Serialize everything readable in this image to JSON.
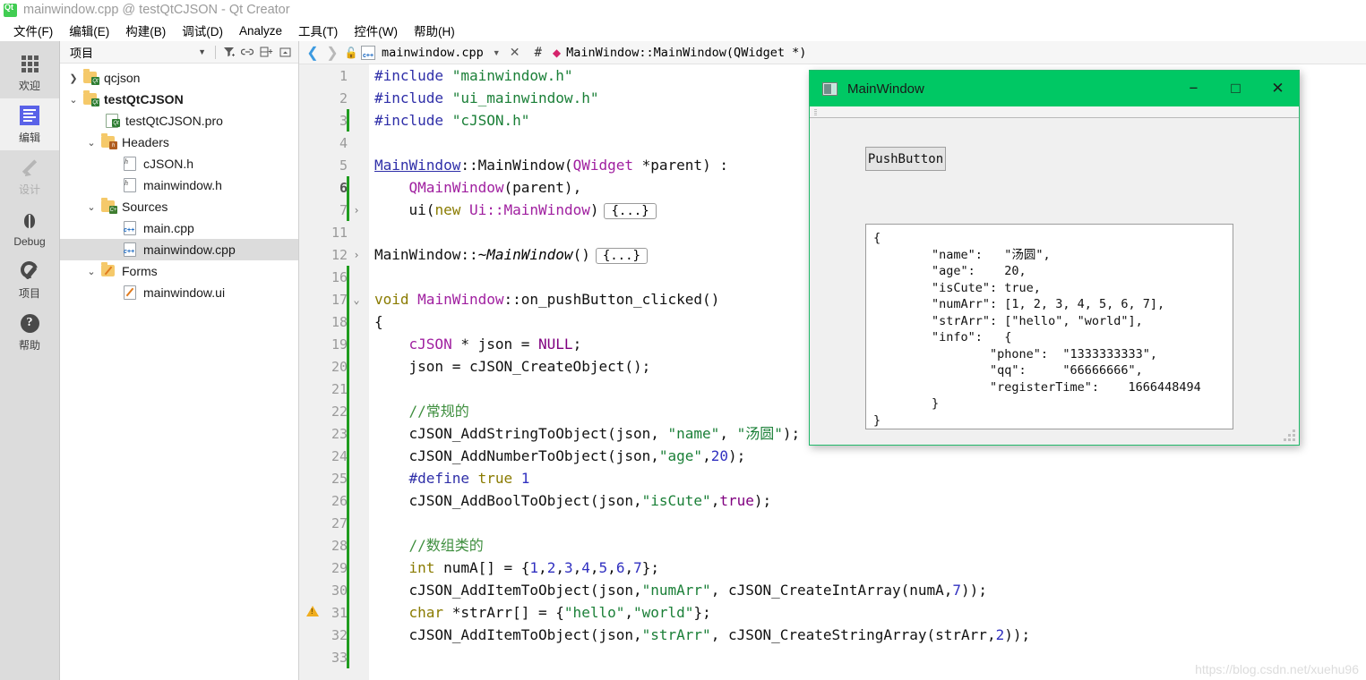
{
  "window": {
    "title": "mainwindow.cpp @ testQtCJSON - Qt Creator",
    "logo_icon": "qt-logo-icon"
  },
  "menubar": {
    "items": [
      {
        "label": "文件(F)",
        "mnemonic": "F"
      },
      {
        "label": "编辑(E)",
        "mnemonic": "E"
      },
      {
        "label": "构建(B)",
        "mnemonic": "B"
      },
      {
        "label": "调试(D)",
        "mnemonic": "D"
      },
      {
        "label": "Analyze",
        "mnemonic": "A"
      },
      {
        "label": "工具(T)",
        "mnemonic": "T"
      },
      {
        "label": "控件(W)",
        "mnemonic": "W"
      },
      {
        "label": "帮助(H)",
        "mnemonic": "H"
      }
    ]
  },
  "modebar": {
    "items": [
      {
        "label": "欢迎",
        "icon": "grid-icon",
        "state": "normal"
      },
      {
        "label": "编辑",
        "icon": "document-edit-icon",
        "state": "selected"
      },
      {
        "label": "设计",
        "icon": "pencil-icon",
        "state": "disabled"
      },
      {
        "label": "Debug",
        "icon": "bug-icon",
        "state": "normal"
      },
      {
        "label": "项目",
        "icon": "wrench-icon",
        "state": "normal"
      },
      {
        "label": "帮助",
        "icon": "question-circle-icon",
        "state": "normal"
      }
    ]
  },
  "sidebar": {
    "header": {
      "combo_label": "项目",
      "caret_icon": "chevron-down-icon",
      "tools": [
        "filter-icon",
        "link-icon",
        "split-icon",
        "collapse-icon"
      ]
    },
    "tree": [
      {
        "label": "qcjson",
        "indent": 0,
        "arrow": "collapsed",
        "icon": "folder-qt-icon",
        "bold": false,
        "selected": false
      },
      {
        "label": "testQtCJSON",
        "indent": 0,
        "arrow": "expanded",
        "icon": "folder-qt-icon",
        "bold": true,
        "selected": false
      },
      {
        "label": "testQtCJSON.pro",
        "indent": 2,
        "arrow": "none",
        "icon": "pro-file-icon",
        "bold": false,
        "selected": false
      },
      {
        "label": "Headers",
        "indent": 1,
        "arrow": "expanded",
        "icon": "folder-h-icon",
        "bold": false,
        "selected": false
      },
      {
        "label": "cJSON.h",
        "indent": 2,
        "arrow": "none",
        "icon": "header-file-icon",
        "bold": false,
        "selected": false
      },
      {
        "label": "mainwindow.h",
        "indent": 2,
        "arrow": "none",
        "icon": "header-file-icon",
        "bold": false,
        "selected": false
      },
      {
        "label": "Sources",
        "indent": 1,
        "arrow": "expanded",
        "icon": "folder-cpp-icon",
        "bold": false,
        "selected": false
      },
      {
        "label": "main.cpp",
        "indent": 2,
        "arrow": "none",
        "icon": "cpp-file-icon",
        "bold": false,
        "selected": false
      },
      {
        "label": "mainwindow.cpp",
        "indent": 2,
        "arrow": "none",
        "icon": "cpp-file-icon",
        "bold": false,
        "selected": true
      },
      {
        "label": "Forms",
        "indent": 1,
        "arrow": "expanded",
        "icon": "folder-ui-icon",
        "bold": false,
        "selected": false
      },
      {
        "label": "mainwindow.ui",
        "indent": 2,
        "arrow": "none",
        "icon": "ui-file-icon",
        "bold": false,
        "selected": false
      }
    ]
  },
  "editor_toolbar": {
    "back_icon": "chevron-left-icon",
    "forward_icon": "chevron-right-icon",
    "lock_icon": "unlocked-icon",
    "file_icon": "cpp-file-icon",
    "filename": "mainwindow.cpp",
    "dropdown_icon": "chevron-down-icon",
    "close_icon": "close-icon",
    "hash_label": "#",
    "symbol_icon": "method-diamond-icon",
    "symbol": "MainWindow::MainWindow(QWidget *)"
  },
  "code": {
    "lines": [
      {
        "num": "1",
        "fold": "",
        "marker": false,
        "warning": false,
        "current": false
      },
      {
        "num": "2",
        "fold": "",
        "marker": false,
        "warning": false,
        "current": false
      },
      {
        "num": "3",
        "fold": "",
        "marker": true,
        "warning": false,
        "current": false
      },
      {
        "num": "4",
        "fold": "",
        "marker": false,
        "warning": false,
        "current": false
      },
      {
        "num": "5",
        "fold": "",
        "marker": false,
        "warning": false,
        "current": false
      },
      {
        "num": "6",
        "fold": "",
        "marker": true,
        "warning": false,
        "current": true
      },
      {
        "num": "7",
        "fold": "›",
        "marker": true,
        "warning": false,
        "current": false
      },
      {
        "num": "11",
        "fold": "",
        "marker": false,
        "warning": false,
        "current": false
      },
      {
        "num": "12",
        "fold": "›",
        "marker": false,
        "warning": false,
        "current": false
      },
      {
        "num": "16",
        "fold": "",
        "marker": true,
        "warning": false,
        "current": false
      },
      {
        "num": "17",
        "fold": "⌄",
        "marker": true,
        "warning": false,
        "current": false
      },
      {
        "num": "18",
        "fold": "",
        "marker": true,
        "warning": false,
        "current": false
      },
      {
        "num": "19",
        "fold": "",
        "marker": true,
        "warning": false,
        "current": false
      },
      {
        "num": "20",
        "fold": "",
        "marker": true,
        "warning": false,
        "current": false
      },
      {
        "num": "21",
        "fold": "",
        "marker": true,
        "warning": false,
        "current": false
      },
      {
        "num": "22",
        "fold": "",
        "marker": true,
        "warning": false,
        "current": false
      },
      {
        "num": "23",
        "fold": "",
        "marker": true,
        "warning": false,
        "current": false
      },
      {
        "num": "24",
        "fold": "",
        "marker": true,
        "warning": false,
        "current": false
      },
      {
        "num": "25",
        "fold": "",
        "marker": true,
        "warning": false,
        "current": false
      },
      {
        "num": "26",
        "fold": "",
        "marker": true,
        "warning": false,
        "current": false
      },
      {
        "num": "27",
        "fold": "",
        "marker": true,
        "warning": false,
        "current": false
      },
      {
        "num": "28",
        "fold": "",
        "marker": true,
        "warning": false,
        "current": false
      },
      {
        "num": "29",
        "fold": "",
        "marker": true,
        "warning": false,
        "current": false
      },
      {
        "num": "30",
        "fold": "",
        "marker": true,
        "warning": false,
        "current": false
      },
      {
        "num": "31",
        "fold": "",
        "marker": true,
        "warning": true,
        "current": false
      },
      {
        "num": "32",
        "fold": "",
        "marker": true,
        "warning": false,
        "current": false
      },
      {
        "num": "33",
        "fold": "",
        "marker": true,
        "warning": false,
        "current": false
      }
    ],
    "text": [
      "#include \"mainwindow.h\"",
      "#include \"ui_mainwindow.h\"",
      "#include \"cJSON.h\"",
      "",
      "MainWindow::MainWindow(QWidget *parent) :",
      "    QMainWindow(parent),",
      "    ui(new Ui::MainWindow) {...}",
      "",
      "MainWindow::~MainWindow() {...}",
      "",
      "void MainWindow::on_pushButton_clicked()",
      "{",
      "    cJSON * json = NULL;",
      "    json = cJSON_CreateObject();",
      "",
      "    //常规的",
      "    cJSON_AddStringToObject(json, \"name\", \"汤圆\");",
      "    cJSON_AddNumberToObject(json,\"age\",20);",
      "    #define true 1",
      "    cJSON_AddBoolToObject(json,\"isCute\",true);",
      "",
      "    //数组类的",
      "    int numA[] = {1,2,3,4,5,6,7};",
      "    cJSON_AddItemToObject(json,\"numArr\", cJSON_CreateIntArray(numA,7));",
      "    char *strArr[] = {\"hello\",\"world\"};",
      "    cJSON_AddItemToObject(json,\"strArr\", cJSON_CreateStringArray(strArr,2));",
      ""
    ],
    "fold_placeholder": "{...}",
    "watermark": "https://blog.csdn.net/xuehu96"
  },
  "dialog": {
    "title": "MainWindow",
    "icon": "window-icon",
    "minimize_icon": "minimize-icon",
    "maximize_icon": "maximize-icon",
    "close_icon": "close-icon",
    "push_button_label": "PushButton",
    "resize_grip_icon": "resize-grip-icon",
    "json_output": "{\n        \"name\":   \"汤圆\",\n        \"age\":    20,\n        \"isCute\": true,\n        \"numArr\": [1, 2, 3, 4, 5, 6, 7],\n        \"strArr\": [\"hello\", \"world\"],\n        \"info\":   {\n                \"phone\":  \"1333333333\",\n                \"qq\":     \"66666666\",\n                \"registerTime\":    1666448494\n        }\n}",
    "json_values": {
      "name": "汤圆",
      "age": 20,
      "isCute": true,
      "numArr": [
        1,
        2,
        3,
        4,
        5,
        6,
        7
      ],
      "strArr": [
        "hello",
        "world"
      ],
      "info": {
        "phone": "1333333333",
        "qq": "66666666",
        "registerTime": 1666448494
      }
    }
  },
  "colors": {
    "accent_green": "#00c864",
    "titlebar_text": "#9b9b9b",
    "selection": "#dcdcdc",
    "gutter_bg": "#f0f0f0",
    "change_marker": "#1f9c1f",
    "warning": "#f0ad1e"
  }
}
